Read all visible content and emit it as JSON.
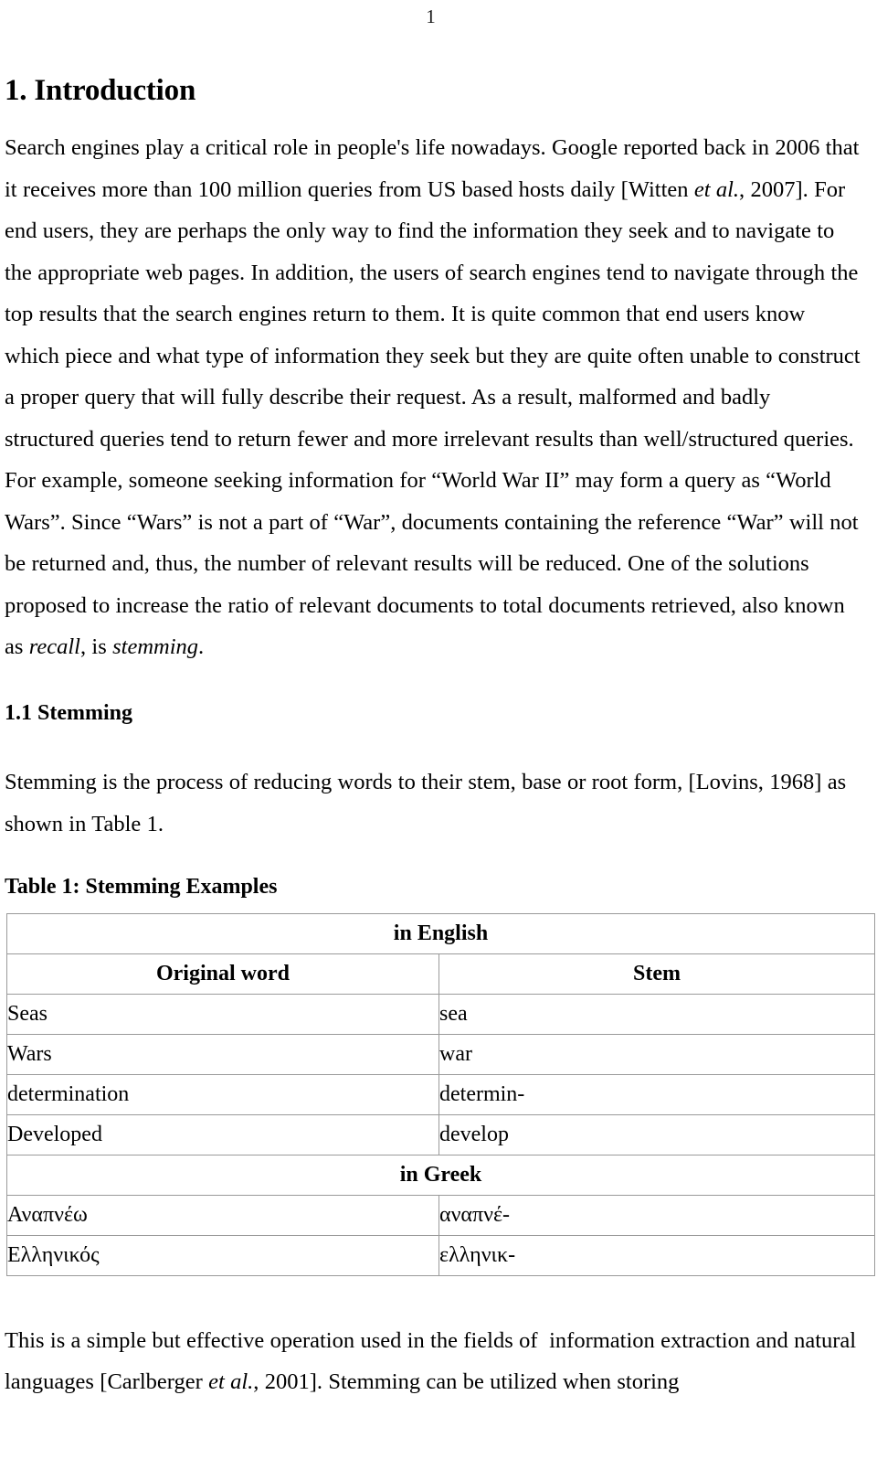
{
  "page": {
    "number": "1"
  },
  "section": {
    "title": "1. Introduction",
    "paragraph_1": "Search engines play a critical role in people's life nowadays. Google reported back in 2006 that it receives more than 100 million queries from US based hosts daily [Witten et al., 2007]. For end users, they are perhaps the only way to find the information they seek and to navigate to the appropriate web pages. In addition, the users of search engines tend to navigate through the top results that the search engines return to them. It is quite common that end users know which piece and what type of information they seek but they are quite often unable to construct a proper query that will fully describe their request. As a result, malformed and badly structured queries tend to return fewer and more irrelevant results than well/structured queries. For example, someone seeking information for “World War II” may form a query as “World Wars”. Since “Wars” is not a part of “War”, documents containing the reference “War” will not be returned and, thus, the number of relevant results will be reduced. One of the solutions proposed to increase the ratio of relevant documents to total documents retrieved, also known as recall, is stemming."
  },
  "subsection": {
    "title": "1.1 Stemming",
    "paragraph_1": "Stemming is the process of reducing words to their stem, base or root form, [Lovins, 1968] as shown in Table 1."
  },
  "table": {
    "caption": "Table 1: Stemming Examples",
    "group_english": "in English",
    "columns": [
      "Original word",
      "Stem"
    ],
    "group_greek": "in Greek",
    "english_rows": [
      {
        "word": "Seas",
        "stem": "sea"
      },
      {
        "word": "Wars",
        "stem": "war"
      },
      {
        "word": "determination",
        "stem": "determin-"
      },
      {
        "word": "Developed",
        "stem": "develop"
      }
    ],
    "greek_rows": [
      {
        "word": "Αναπνέω",
        "stem": "αναπνέ-"
      },
      {
        "word": "Ελληνικός",
        "stem": "ελληνικ-"
      }
    ]
  },
  "closing": {
    "paragraph_1": "This is a simple but effective operation used in the fields of  information extraction and natural languages [Carlberger et al., 2001]. Stemming can be utilized when storing"
  }
}
